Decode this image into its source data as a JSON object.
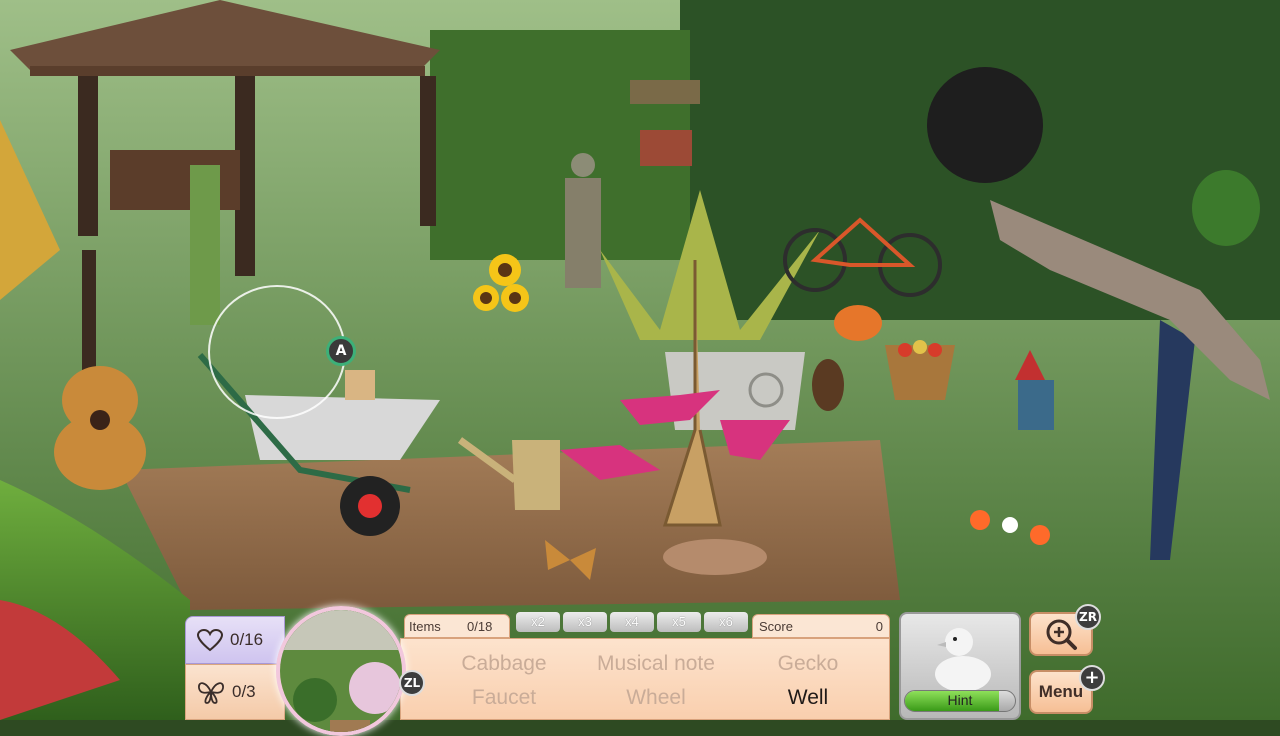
{
  "game": {
    "hearts": "0/16",
    "butterflies": "0/3",
    "items_label": "Items",
    "items_count": "0/18",
    "multipliers": [
      "x2",
      "x3",
      "x4",
      "x5",
      "x6"
    ],
    "score_label": "Score",
    "score_value": "0",
    "hint_label": "Hint",
    "hint_progress": 0.85,
    "menu_label": "Menu",
    "zl_label": "ZL",
    "zr_label": "ZR",
    "a_label": "A",
    "plus_label": "+"
  },
  "word_list": [
    {
      "label": "Cabbage",
      "found": true
    },
    {
      "label": "Musical note",
      "found": true
    },
    {
      "label": "Gecko",
      "found": true
    },
    {
      "label": "Faucet",
      "found": true
    },
    {
      "label": "Wheel",
      "found": true
    },
    {
      "label": "Well",
      "found": false
    }
  ],
  "colors": {
    "panel": "#f9cfae",
    "hearts_panel": "#cfc4ef",
    "hint_fill": "#3a9a18",
    "cursor_ring": "#3db078"
  }
}
